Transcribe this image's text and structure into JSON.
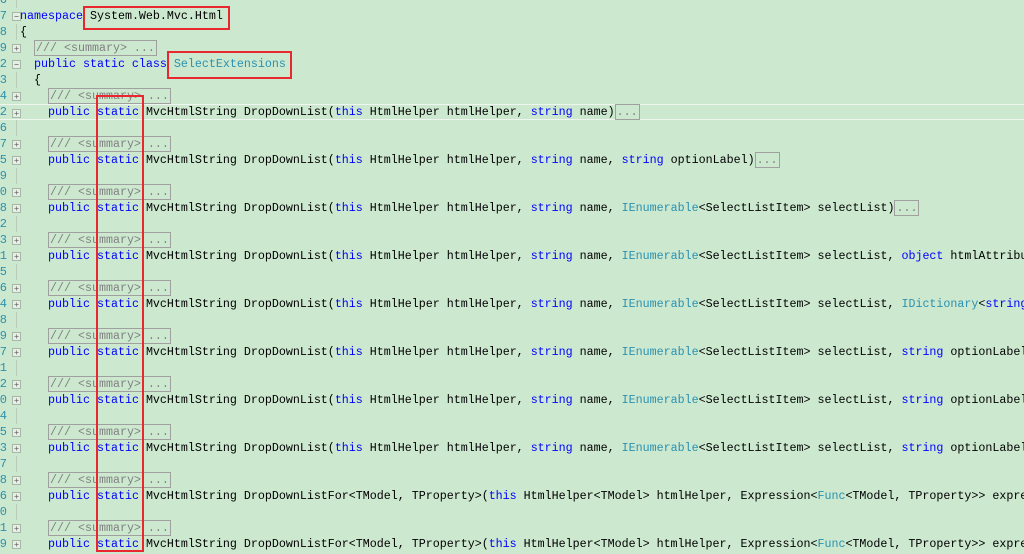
{
  "colors": {
    "background": "#cce8cf",
    "keyword": "#0000ff",
    "type": "#2b91af",
    "highlight_box": "#e8282e"
  },
  "lines": [
    {
      "n": "6",
      "fold": "",
      "indent": 0,
      "tokens": []
    },
    {
      "n": "7",
      "fold": "minus",
      "indent": 0,
      "tokens": [
        {
          "t": "namespace",
          "s": "k"
        },
        {
          "t": " ",
          "s": "p"
        },
        {
          "t": "System.Web.Mvc.Html",
          "s": "p"
        }
      ]
    },
    {
      "n": "8",
      "fold": "",
      "indent": 0,
      "tokens": [
        {
          "t": "{",
          "s": "p"
        }
      ]
    },
    {
      "n": "9",
      "fold": "plus",
      "indent": 1,
      "tokens": [
        {
          "t": "/// <summary> ...",
          "s": "c"
        }
      ]
    },
    {
      "n": "2",
      "fold": "minus",
      "indent": 1,
      "tokens": [
        {
          "t": "public static class ",
          "s": "k"
        },
        {
          "t": "SelectExtensions",
          "s": "t"
        }
      ]
    },
    {
      "n": "3",
      "fold": "",
      "indent": 1,
      "tokens": [
        {
          "t": "{",
          "s": "p"
        }
      ]
    },
    {
      "n": "4",
      "fold": "plus",
      "indent": 2,
      "tokens": [
        {
          "t": "/// <summary> ...",
          "s": "c"
        }
      ]
    },
    {
      "n": "2",
      "fold": "plus",
      "indent": 2,
      "current": true,
      "tokens": [
        {
          "t": "public static ",
          "s": "k"
        },
        {
          "t": "MvcHtmlString DropDownList(",
          "s": "p"
        },
        {
          "t": "this",
          "s": "k"
        },
        {
          "t": " HtmlHelper htmlHelper, ",
          "s": "p"
        },
        {
          "t": "string",
          "s": "k"
        },
        {
          "t": " name)",
          "s": "p"
        },
        {
          "t": "...",
          "s": "e"
        }
      ]
    },
    {
      "n": "6",
      "fold": "",
      "indent": 2,
      "tokens": []
    },
    {
      "n": "7",
      "fold": "plus",
      "indent": 2,
      "tokens": [
        {
          "t": "/// <summary> ...",
          "s": "c"
        }
      ]
    },
    {
      "n": "5",
      "fold": "plus",
      "indent": 2,
      "tokens": [
        {
          "t": "public static ",
          "s": "k"
        },
        {
          "t": "MvcHtmlString DropDownList(",
          "s": "p"
        },
        {
          "t": "this",
          "s": "k"
        },
        {
          "t": " HtmlHelper htmlHelper, ",
          "s": "p"
        },
        {
          "t": "string",
          "s": "k"
        },
        {
          "t": " name, ",
          "s": "p"
        },
        {
          "t": "string",
          "s": "k"
        },
        {
          "t": " optionLabel)",
          "s": "p"
        },
        {
          "t": "...",
          "s": "e"
        }
      ]
    },
    {
      "n": "9",
      "fold": "",
      "indent": 2,
      "tokens": []
    },
    {
      "n": "0",
      "fold": "plus",
      "indent": 2,
      "tokens": [
        {
          "t": "/// <summary> ...",
          "s": "c"
        }
      ]
    },
    {
      "n": "8",
      "fold": "plus",
      "indent": 2,
      "tokens": [
        {
          "t": "public static ",
          "s": "k"
        },
        {
          "t": "MvcHtmlString DropDownList(",
          "s": "p"
        },
        {
          "t": "this",
          "s": "k"
        },
        {
          "t": " HtmlHelper htmlHelper, ",
          "s": "p"
        },
        {
          "t": "string",
          "s": "k"
        },
        {
          "t": " name, ",
          "s": "p"
        },
        {
          "t": "IEnumerable",
          "s": "t"
        },
        {
          "t": "<SelectListItem> selectList)",
          "s": "p"
        },
        {
          "t": "...",
          "s": "e"
        }
      ]
    },
    {
      "n": "2",
      "fold": "",
      "indent": 2,
      "tokens": []
    },
    {
      "n": "3",
      "fold": "plus",
      "indent": 2,
      "tokens": [
        {
          "t": "/// <summary> ...",
          "s": "c"
        }
      ]
    },
    {
      "n": "1",
      "fold": "plus",
      "indent": 2,
      "tokens": [
        {
          "t": "public static ",
          "s": "k"
        },
        {
          "t": "MvcHtmlString DropDownList(",
          "s": "p"
        },
        {
          "t": "this",
          "s": "k"
        },
        {
          "t": " HtmlHelper htmlHelper, ",
          "s": "p"
        },
        {
          "t": "string",
          "s": "k"
        },
        {
          "t": " name, ",
          "s": "p"
        },
        {
          "t": "IEnumerable",
          "s": "t"
        },
        {
          "t": "<SelectListItem> selectList, ",
          "s": "p"
        },
        {
          "t": "object",
          "s": "k"
        },
        {
          "t": " htmlAttribut",
          "s": "p"
        }
      ]
    },
    {
      "n": "5",
      "fold": "",
      "indent": 2,
      "tokens": []
    },
    {
      "n": "6",
      "fold": "plus",
      "indent": 2,
      "tokens": [
        {
          "t": "/// <summary> ...",
          "s": "c"
        }
      ]
    },
    {
      "n": "4",
      "fold": "plus",
      "indent": 2,
      "tokens": [
        {
          "t": "public static ",
          "s": "k"
        },
        {
          "t": "MvcHtmlString DropDownList(",
          "s": "p"
        },
        {
          "t": "this",
          "s": "k"
        },
        {
          "t": " HtmlHelper htmlHelper, ",
          "s": "p"
        },
        {
          "t": "string",
          "s": "k"
        },
        {
          "t": " name, ",
          "s": "p"
        },
        {
          "t": "IEnumerable",
          "s": "t"
        },
        {
          "t": "<SelectListItem> selectList, ",
          "s": "p"
        },
        {
          "t": "IDictionary",
          "s": "t"
        },
        {
          "t": "<",
          "s": "p"
        },
        {
          "t": "string",
          "s": "k"
        },
        {
          "t": ",",
          "s": "p"
        }
      ]
    },
    {
      "n": "8",
      "fold": "",
      "indent": 2,
      "tokens": []
    },
    {
      "n": "9",
      "fold": "plus",
      "indent": 2,
      "tokens": [
        {
          "t": "/// <summary> ...",
          "s": "c"
        }
      ]
    },
    {
      "n": "7",
      "fold": "plus",
      "indent": 2,
      "tokens": [
        {
          "t": "public static ",
          "s": "k"
        },
        {
          "t": "MvcHtmlString DropDownList(",
          "s": "p"
        },
        {
          "t": "this",
          "s": "k"
        },
        {
          "t": " HtmlHelper htmlHelper, ",
          "s": "p"
        },
        {
          "t": "string",
          "s": "k"
        },
        {
          "t": " name, ",
          "s": "p"
        },
        {
          "t": "IEnumerable",
          "s": "t"
        },
        {
          "t": "<SelectListItem> selectList, ",
          "s": "p"
        },
        {
          "t": "string",
          "s": "k"
        },
        {
          "t": " optionLabel)",
          "s": "p"
        }
      ]
    },
    {
      "n": "1",
      "fold": "",
      "indent": 2,
      "tokens": []
    },
    {
      "n": "2",
      "fold": "plus",
      "indent": 2,
      "tokens": [
        {
          "t": "/// <summary> ...",
          "s": "c"
        }
      ]
    },
    {
      "n": "0",
      "fold": "plus",
      "indent": 2,
      "tokens": [
        {
          "t": "public static ",
          "s": "k"
        },
        {
          "t": "MvcHtmlString DropDownList(",
          "s": "p"
        },
        {
          "t": "this",
          "s": "k"
        },
        {
          "t": " HtmlHelper htmlHelper, ",
          "s": "p"
        },
        {
          "t": "string",
          "s": "k"
        },
        {
          "t": " name, ",
          "s": "p"
        },
        {
          "t": "IEnumerable",
          "s": "t"
        },
        {
          "t": "<SelectListItem> selectList, ",
          "s": "p"
        },
        {
          "t": "string",
          "s": "k"
        },
        {
          "t": " optionLabel,",
          "s": "p"
        }
      ]
    },
    {
      "n": "4",
      "fold": "",
      "indent": 2,
      "tokens": []
    },
    {
      "n": "5",
      "fold": "plus",
      "indent": 2,
      "tokens": [
        {
          "t": "/// <summary> ...",
          "s": "c"
        }
      ]
    },
    {
      "n": "3",
      "fold": "plus",
      "indent": 2,
      "tokens": [
        {
          "t": "public static ",
          "s": "k"
        },
        {
          "t": "MvcHtmlString DropDownList(",
          "s": "p"
        },
        {
          "t": "this",
          "s": "k"
        },
        {
          "t": " HtmlHelper htmlHelper, ",
          "s": "p"
        },
        {
          "t": "string",
          "s": "k"
        },
        {
          "t": " name, ",
          "s": "p"
        },
        {
          "t": "IEnumerable",
          "s": "t"
        },
        {
          "t": "<SelectListItem> selectList, ",
          "s": "p"
        },
        {
          "t": "string",
          "s": "k"
        },
        {
          "t": " optionLabel,",
          "s": "p"
        }
      ]
    },
    {
      "n": "7",
      "fold": "",
      "indent": 2,
      "tokens": []
    },
    {
      "n": "8",
      "fold": "plus",
      "indent": 2,
      "tokens": [
        {
          "t": "/// <summary> ...",
          "s": "c"
        }
      ]
    },
    {
      "n": "6",
      "fold": "plus",
      "indent": 2,
      "tokens": [
        {
          "t": "public static ",
          "s": "k"
        },
        {
          "t": "MvcHtmlString DropDownListFor<TModel, TProperty>(",
          "s": "p"
        },
        {
          "t": "this",
          "s": "k"
        },
        {
          "t": " HtmlHelper<TModel> htmlHelper, Expression<",
          "s": "p"
        },
        {
          "t": "Func",
          "s": "t"
        },
        {
          "t": "<TModel, TProperty>> expres",
          "s": "p"
        }
      ]
    },
    {
      "n": "0",
      "fold": "",
      "indent": 2,
      "tokens": []
    },
    {
      "n": "1",
      "fold": "plus",
      "indent": 2,
      "tokens": [
        {
          "t": "/// <summary> ...",
          "s": "c"
        }
      ]
    },
    {
      "n": "9",
      "fold": "plus",
      "indent": 2,
      "tokens": [
        {
          "t": "public static ",
          "s": "k"
        },
        {
          "t": "MvcHtmlString DropDownListFor<TModel, TProperty>(",
          "s": "p"
        },
        {
          "t": "this",
          "s": "k"
        },
        {
          "t": " HtmlHelper<TModel> htmlHelper, Expression<",
          "s": "p"
        },
        {
          "t": "Func",
          "s": "t"
        },
        {
          "t": "<TModel, TProperty>> expres",
          "s": "p"
        }
      ]
    }
  ]
}
